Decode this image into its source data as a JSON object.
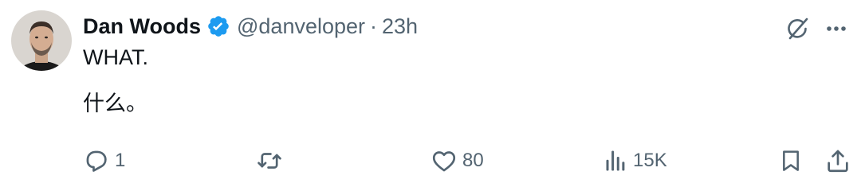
{
  "author": {
    "name": "Dan Woods",
    "handle": "@danveloper",
    "separator": "·",
    "time": "23h"
  },
  "icons": {
    "avatar": "profile-photo",
    "verified": "verified-badge-icon",
    "grok": "grok-icon",
    "more": "more-icon",
    "reply": "reply-icon",
    "retweet": "retweet-icon",
    "like": "like-icon",
    "views": "views-icon",
    "bookmark": "bookmark-icon",
    "share": "share-icon"
  },
  "content": {
    "line1": "WHAT.",
    "line2": "什么。"
  },
  "actions": {
    "reply_count": "1",
    "like_count": "80",
    "views_count": "15K"
  },
  "colors": {
    "verified": "#1d9bf0",
    "text": "#0f1419",
    "muted": "#536471"
  }
}
